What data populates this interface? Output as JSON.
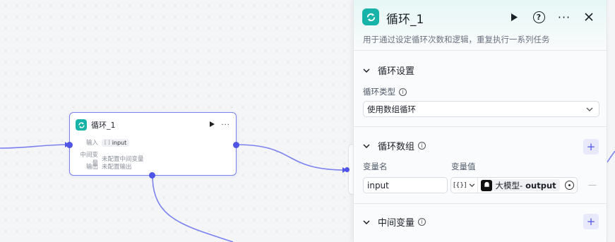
{
  "canvas": {
    "loop_node": {
      "title": "循环_1",
      "input_label": "输入",
      "input_chip_bracket": "[ ]",
      "input_chip_value": "input",
      "intermediate_label": "中间变量",
      "intermediate_value": "未配置中间变量",
      "output_label": "输出",
      "output_value": "未配置输出",
      "run_icon": "play-icon",
      "more_icon": "more-icon"
    },
    "wire_color": "#7b82f0",
    "port_color": "#4e55e6"
  },
  "panel": {
    "title": "循环_1",
    "description": "用于通过设定循环次数和逻辑，重复执行一系列任务",
    "accent": "#17b3a9",
    "header_icons": [
      "play-icon",
      "help-icon",
      "more-icon",
      "close-icon"
    ],
    "help_glyph": "?",
    "loop_settings": {
      "title": "循环设置",
      "type_label": "循环类型",
      "type_value": "使用数组循环"
    },
    "loop_array": {
      "title": "循环数组",
      "add_glyph": "+",
      "col_name": "变量名",
      "col_value": "变量值",
      "row": {
        "name": "input",
        "type_glyph": "[{}]",
        "source_name": "大模型",
        "separator": " - ",
        "source_output": "output",
        "remove_glyph": "—"
      }
    },
    "intermediate": {
      "title": "中间变量",
      "add_glyph": "+"
    }
  }
}
